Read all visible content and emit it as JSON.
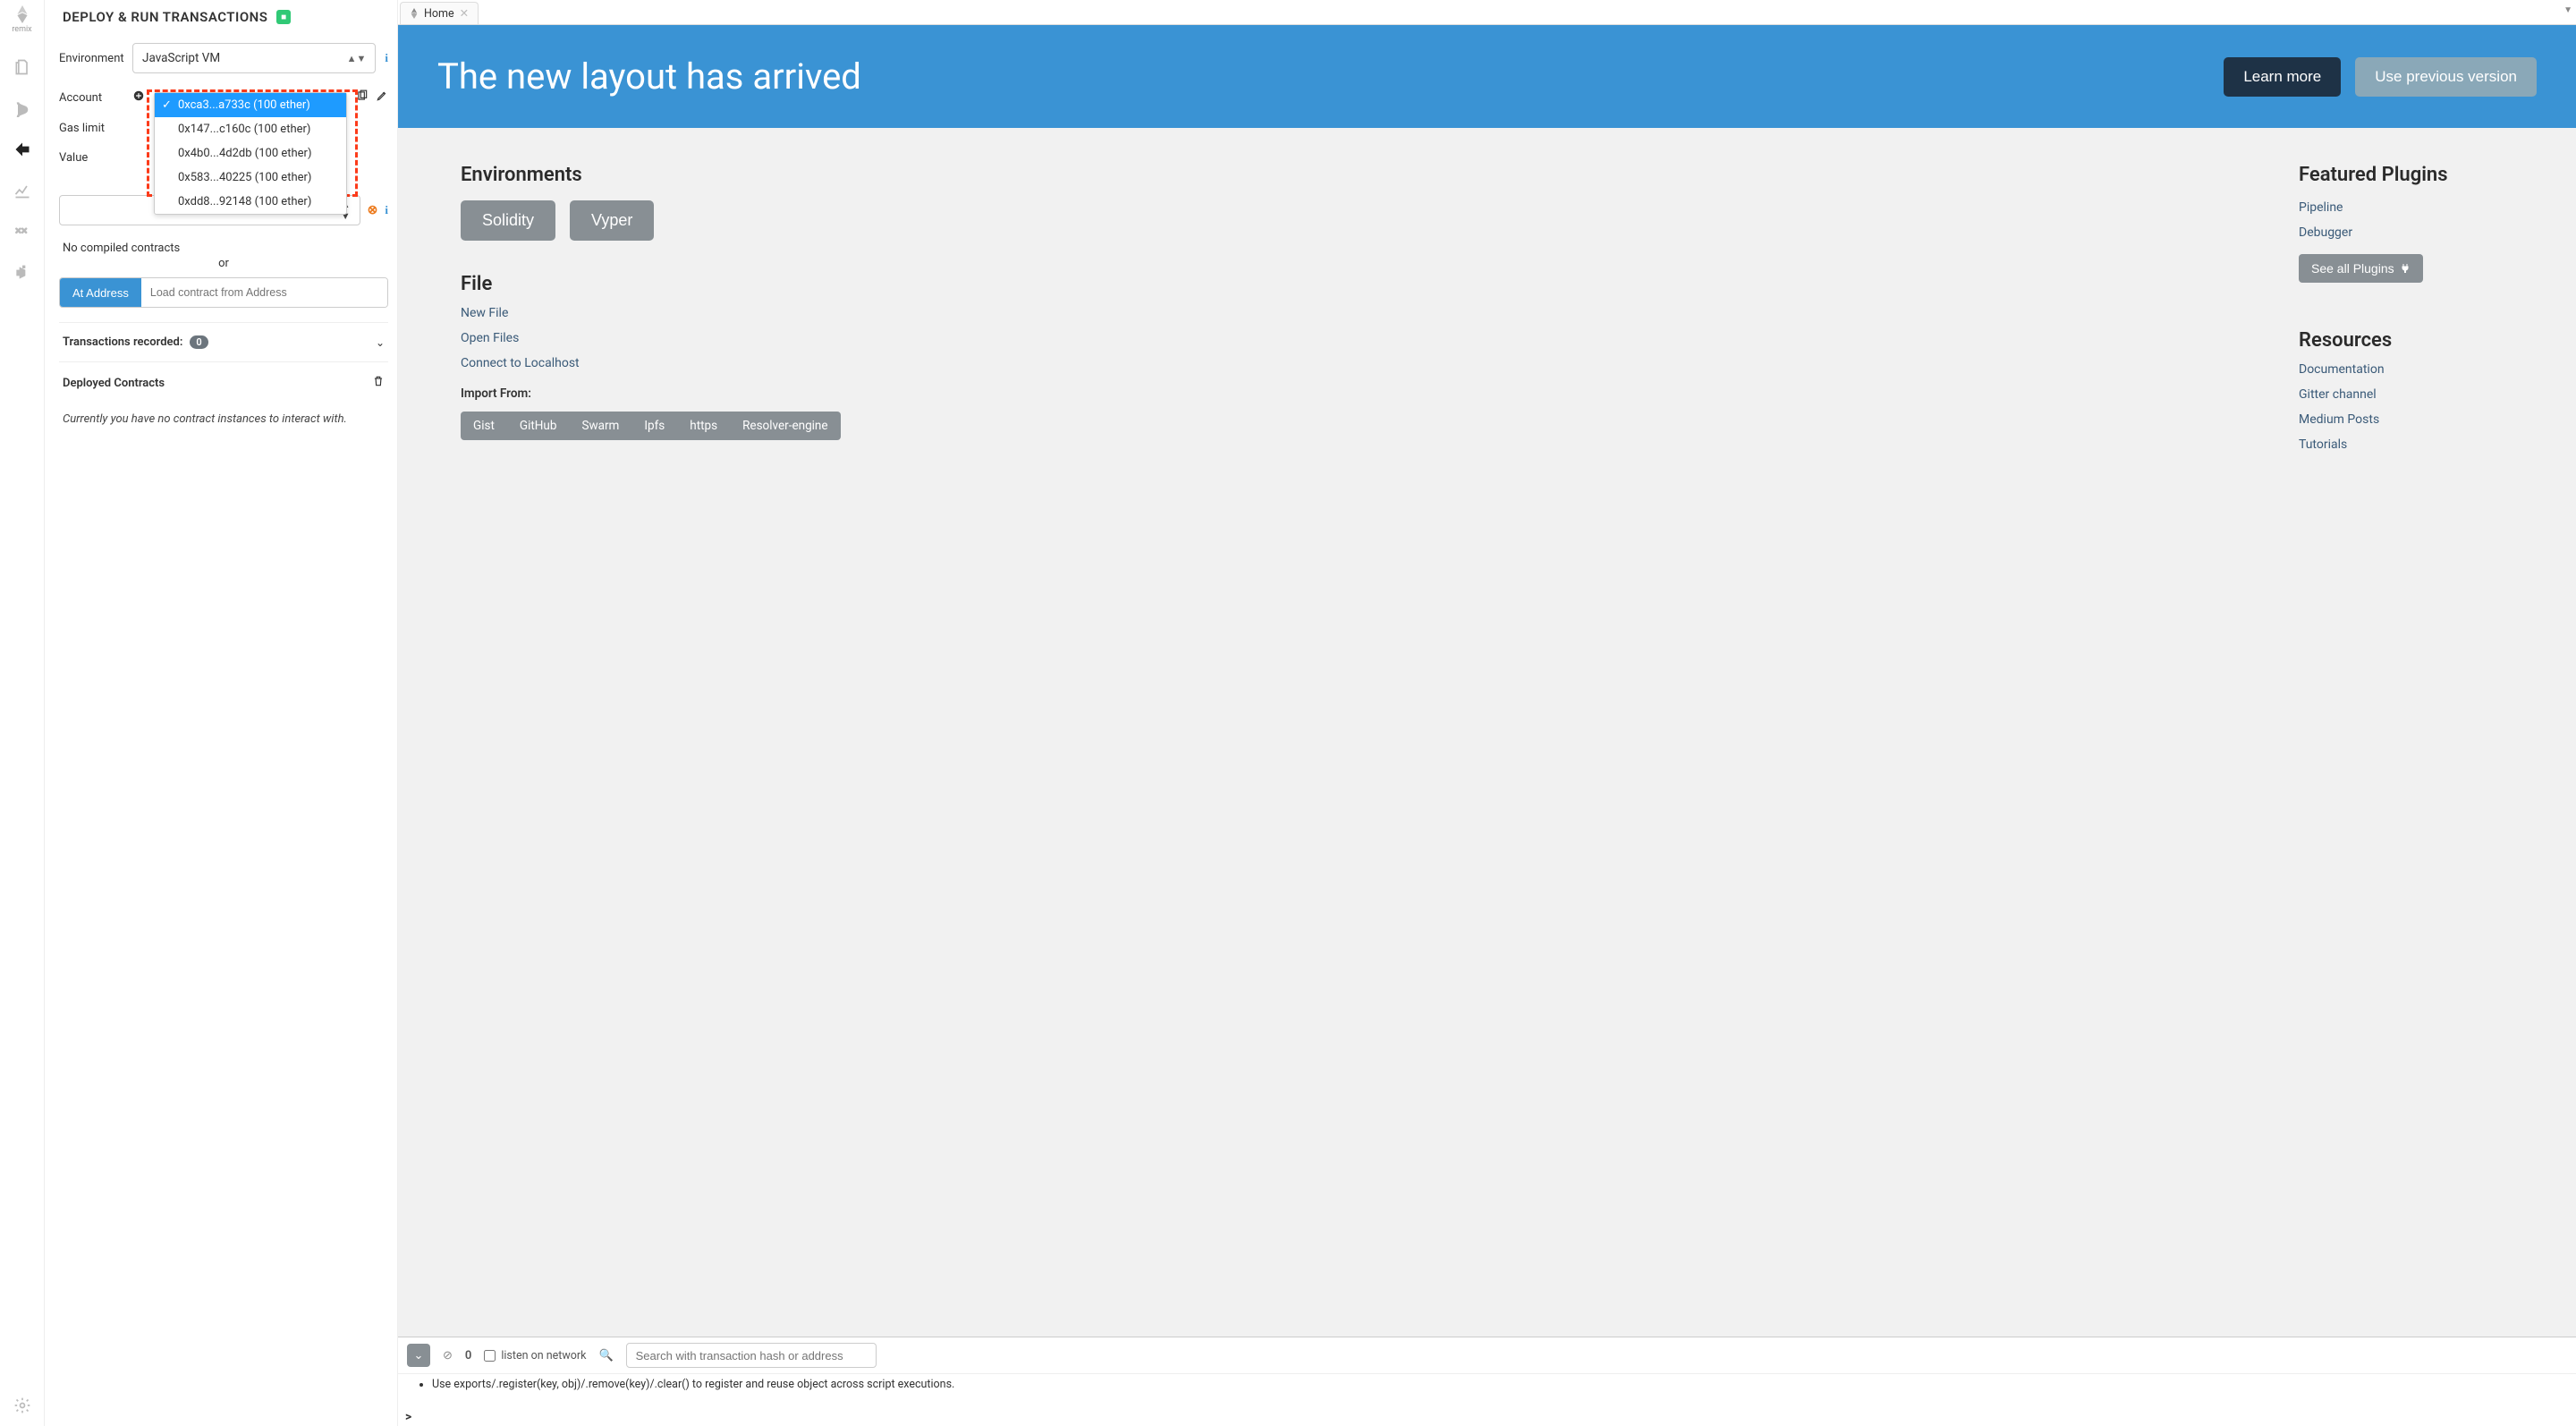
{
  "app": {
    "logo_text": "remix"
  },
  "panel": {
    "title": "DEPLOY & RUN TRANSACTIONS",
    "env_label": "Environment",
    "env_value": "JavaScript VM",
    "account_label": "Account",
    "accounts": [
      "0xca3...a733c (100 ether)",
      "0x147...c160c (100 ether)",
      "0x4b0...4d2db (100 ether)",
      "0x583...40225 (100 ether)",
      "0xdd8...92148 (100 ether)"
    ],
    "gas_label": "Gas limit",
    "value_label": "Value",
    "no_compiled": "No compiled contracts",
    "or": "or",
    "at_address": "At Address",
    "addr_placeholder": "Load contract from Address",
    "tx_recorded": "Transactions recorded:",
    "tx_count": "0",
    "deployed": "Deployed Contracts",
    "none_msg": "Currently you have no contract instances to interact with."
  },
  "tab": {
    "label": "Home"
  },
  "banner": {
    "title": "The new layout has arrived",
    "learn": "Learn more",
    "prev": "Use previous version"
  },
  "home": {
    "env_title": "Environments",
    "sol": "Solidity",
    "vyper": "Vyper",
    "file_title": "File",
    "new_file": "New File",
    "open_files": "Open Files",
    "connect": "Connect to Localhost",
    "import_label": "Import From:",
    "imports": [
      "Gist",
      "GitHub",
      "Swarm",
      "Ipfs",
      "https",
      "Resolver-engine"
    ],
    "featured_title": "Featured Plugins",
    "featured": [
      "Pipeline",
      "Debugger"
    ],
    "see_all": "See all Plugins",
    "resources_title": "Resources",
    "resources": [
      "Documentation",
      "Gitter channel",
      "Medium Posts",
      "Tutorials"
    ]
  },
  "term": {
    "pending": "0",
    "listen": "listen on network",
    "search_placeholder": "Search with transaction hash or address",
    "line": "Use exports/.register(key, obj)/.remove(key)/.clear() to register and reuse object across script executions.",
    "prompt": ">"
  }
}
